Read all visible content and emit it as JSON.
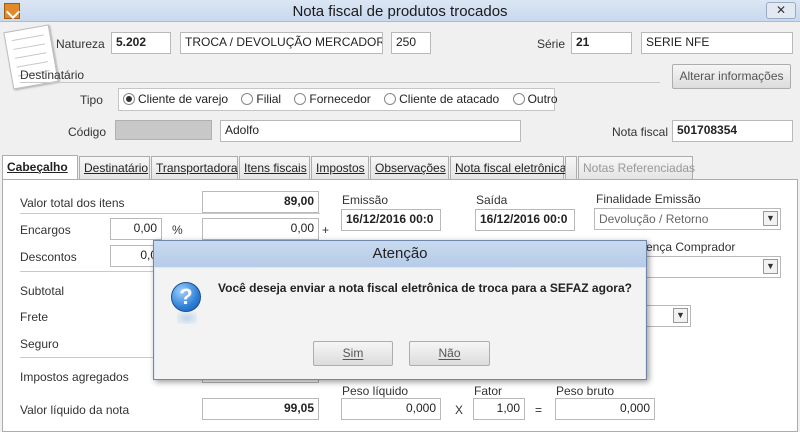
{
  "window": {
    "title": "Nota fiscal de produtos trocados",
    "close_symbol": "✕"
  },
  "header": {
    "natureza_label": "Natureza",
    "natureza_code": "5.202",
    "natureza_desc": "TROCA / DEVOLUÇÃO MERCADORIA",
    "natureza_num": "250",
    "serie_label": "Série",
    "serie_code": "21",
    "serie_desc": "SERIE NFE",
    "destinatario_label": "Destinatário",
    "alterar_button": "Alterar informações",
    "tipo_label": "Tipo",
    "tipo_options": [
      "Cliente de varejo",
      "Filial",
      "Fornecedor",
      "Cliente de atacado",
      "Outro"
    ],
    "tipo_selected": "Cliente de varejo",
    "codigo_label": "Código",
    "codigo_name": "Adolfo",
    "nota_fiscal_label": "Nota fiscal",
    "nota_fiscal_value": "501708354"
  },
  "tabs": [
    {
      "label": "Cabeçalho",
      "active": true
    },
    {
      "label": "Destinatário"
    },
    {
      "label": "Transportadora"
    },
    {
      "label": "Itens fiscais"
    },
    {
      "label": "Impostos"
    },
    {
      "label": "Observações"
    },
    {
      "label": "Nota fiscal eletrônica"
    },
    {
      "label": ""
    },
    {
      "label": "Notas Referenciadas",
      "disabled": true
    }
  ],
  "cabecalho": {
    "valor_total_label": "Valor total dos itens",
    "valor_total": "89,00",
    "encargos_label": "Encargos",
    "encargos_pct": "0,00",
    "pct_symbol": "%",
    "encargos_value": "0,00",
    "plus_symbol": "+",
    "descontos_label": "Descontos",
    "descontos_pct": "0,0",
    "subtotal_label": "Subtotal",
    "frete_label": "Frete",
    "seguro_label": "Seguro",
    "impostos_label": "Impostos agregados",
    "valor_liquido_label": "Valor líquido da nota",
    "valor_liquido": "99,05",
    "emissao_label": "Emissão",
    "emissao_value": "16/12/2016 00:0",
    "saida_label": "Saída",
    "saida_value": "16/12/2016 00:0",
    "finalidade_label": "Finalidade Emissão",
    "finalidade_value": "Devolução / Retorno",
    "presenca_label": "ença Comprador",
    "peso_liquido_label": "Peso líquido",
    "peso_liquido": "0,000",
    "x_symbol": "X",
    "fator_label": "Fator",
    "fator": "1,00",
    "eq_symbol": "=",
    "peso_bruto_label": "Peso bruto",
    "peso_bruto": "0,000"
  },
  "dialog": {
    "title": "Atenção",
    "message": "Você deseja enviar a nota fiscal eletrônica de troca para a SEFAZ agora?",
    "icon_glyph": "?",
    "sim_button": "Sim",
    "nao_button": "Não"
  }
}
